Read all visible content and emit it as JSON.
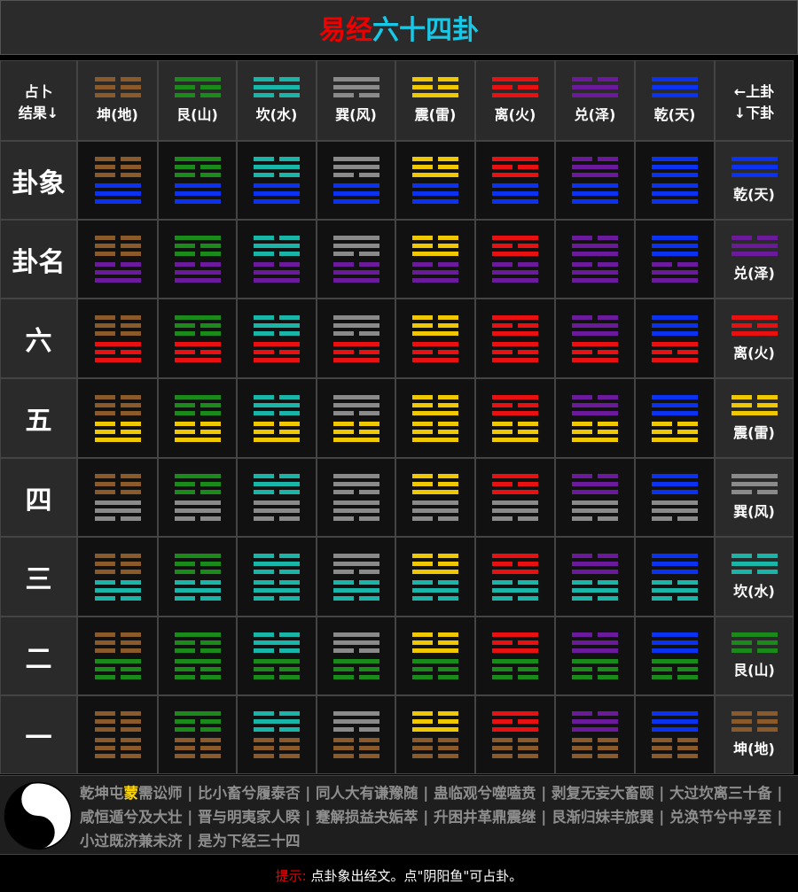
{
  "title": {
    "part1": "易经",
    "part2": "六十四卦"
  },
  "corner_label": [
    "占卜",
    "结果↓"
  ],
  "right_corner_label": [
    "←上卦",
    "↓下卦"
  ],
  "trigrams": {
    "kun": {
      "name": "坤(地)",
      "color": "#8b5a2b",
      "lines": [
        0,
        0,
        0
      ]
    },
    "gen": {
      "name": "艮(山)",
      "color": "#1a8a1a",
      "lines": [
        1,
        0,
        0
      ]
    },
    "kan": {
      "name": "坎(水)",
      "color": "#19b5a8",
      "lines": [
        0,
        1,
        0
      ]
    },
    "xun": {
      "name": "巽(风)",
      "color": "#8a8a8a",
      "lines": [
        1,
        1,
        0
      ]
    },
    "zhen": {
      "name": "震(雷)",
      "color": "#f0c800",
      "lines": [
        0,
        0,
        1
      ]
    },
    "li": {
      "name": "离(火)",
      "color": "#e81010",
      "lines": [
        1,
        0,
        1
      ]
    },
    "dui": {
      "name": "兑(泽)",
      "color": "#6a1a9a",
      "lines": [
        0,
        1,
        1
      ]
    },
    "qian": {
      "name": "乾(天)",
      "color": "#0a32f0",
      "lines": [
        1,
        1,
        1
      ]
    }
  },
  "column_order": [
    "kun",
    "gen",
    "kan",
    "xun",
    "zhen",
    "li",
    "dui",
    "qian"
  ],
  "rows": [
    {
      "label": "卦象",
      "lower": "qian"
    },
    {
      "label": "卦名",
      "lower": "dui"
    },
    {
      "label": "六",
      "lower": "li"
    },
    {
      "label": "五",
      "lower": "zhen"
    },
    {
      "label": "四",
      "lower": "xun"
    },
    {
      "label": "三",
      "lower": "kan"
    },
    {
      "label": "二",
      "lower": "gen"
    },
    {
      "label": "一",
      "lower": "kun"
    }
  ],
  "sequence": {
    "lead": "乾坤屯",
    "highlight": "蒙",
    "rest": "需讼师 | 比小畜兮履泰否 | 同人大有谦豫随 | 蛊临观兮噬嗑贲 | 剥复无妄大畜颐 | 大过坎离三十备 | 咸恒遁兮及大壮 | 晋与明夷家人睽 | 蹇解损益夬姤萃 | 升困井革鼎震继 | 艮渐归妹丰旅巽 | 兑涣节兮中孚至 | 小过既济兼未济 | 是为下经三十四",
    "highlight_color": "#ffd700"
  },
  "footer": {
    "key": "提示:",
    "text": " 点卦象出经文。点\"阴阳鱼\"可占卦。"
  }
}
